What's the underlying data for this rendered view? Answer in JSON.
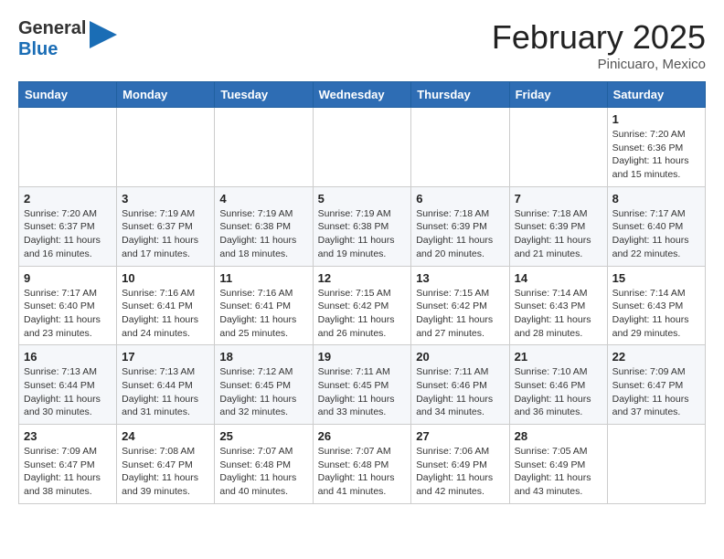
{
  "header": {
    "logo_general": "General",
    "logo_blue": "Blue",
    "month_title": "February 2025",
    "subtitle": "Pinicuaro, Mexico"
  },
  "days_of_week": [
    "Sunday",
    "Monday",
    "Tuesday",
    "Wednesday",
    "Thursday",
    "Friday",
    "Saturday"
  ],
  "weeks": [
    [
      {
        "day": "",
        "info": ""
      },
      {
        "day": "",
        "info": ""
      },
      {
        "day": "",
        "info": ""
      },
      {
        "day": "",
        "info": ""
      },
      {
        "day": "",
        "info": ""
      },
      {
        "day": "",
        "info": ""
      },
      {
        "day": "1",
        "info": "Sunrise: 7:20 AM\nSunset: 6:36 PM\nDaylight: 11 hours\nand 15 minutes."
      }
    ],
    [
      {
        "day": "2",
        "info": "Sunrise: 7:20 AM\nSunset: 6:37 PM\nDaylight: 11 hours\nand 16 minutes."
      },
      {
        "day": "3",
        "info": "Sunrise: 7:19 AM\nSunset: 6:37 PM\nDaylight: 11 hours\nand 17 minutes."
      },
      {
        "day": "4",
        "info": "Sunrise: 7:19 AM\nSunset: 6:38 PM\nDaylight: 11 hours\nand 18 minutes."
      },
      {
        "day": "5",
        "info": "Sunrise: 7:19 AM\nSunset: 6:38 PM\nDaylight: 11 hours\nand 19 minutes."
      },
      {
        "day": "6",
        "info": "Sunrise: 7:18 AM\nSunset: 6:39 PM\nDaylight: 11 hours\nand 20 minutes."
      },
      {
        "day": "7",
        "info": "Sunrise: 7:18 AM\nSunset: 6:39 PM\nDaylight: 11 hours\nand 21 minutes."
      },
      {
        "day": "8",
        "info": "Sunrise: 7:17 AM\nSunset: 6:40 PM\nDaylight: 11 hours\nand 22 minutes."
      }
    ],
    [
      {
        "day": "9",
        "info": "Sunrise: 7:17 AM\nSunset: 6:40 PM\nDaylight: 11 hours\nand 23 minutes."
      },
      {
        "day": "10",
        "info": "Sunrise: 7:16 AM\nSunset: 6:41 PM\nDaylight: 11 hours\nand 24 minutes."
      },
      {
        "day": "11",
        "info": "Sunrise: 7:16 AM\nSunset: 6:41 PM\nDaylight: 11 hours\nand 25 minutes."
      },
      {
        "day": "12",
        "info": "Sunrise: 7:15 AM\nSunset: 6:42 PM\nDaylight: 11 hours\nand 26 minutes."
      },
      {
        "day": "13",
        "info": "Sunrise: 7:15 AM\nSunset: 6:42 PM\nDaylight: 11 hours\nand 27 minutes."
      },
      {
        "day": "14",
        "info": "Sunrise: 7:14 AM\nSunset: 6:43 PM\nDaylight: 11 hours\nand 28 minutes."
      },
      {
        "day": "15",
        "info": "Sunrise: 7:14 AM\nSunset: 6:43 PM\nDaylight: 11 hours\nand 29 minutes."
      }
    ],
    [
      {
        "day": "16",
        "info": "Sunrise: 7:13 AM\nSunset: 6:44 PM\nDaylight: 11 hours\nand 30 minutes."
      },
      {
        "day": "17",
        "info": "Sunrise: 7:13 AM\nSunset: 6:44 PM\nDaylight: 11 hours\nand 31 minutes."
      },
      {
        "day": "18",
        "info": "Sunrise: 7:12 AM\nSunset: 6:45 PM\nDaylight: 11 hours\nand 32 minutes."
      },
      {
        "day": "19",
        "info": "Sunrise: 7:11 AM\nSunset: 6:45 PM\nDaylight: 11 hours\nand 33 minutes."
      },
      {
        "day": "20",
        "info": "Sunrise: 7:11 AM\nSunset: 6:46 PM\nDaylight: 11 hours\nand 34 minutes."
      },
      {
        "day": "21",
        "info": "Sunrise: 7:10 AM\nSunset: 6:46 PM\nDaylight: 11 hours\nand 36 minutes."
      },
      {
        "day": "22",
        "info": "Sunrise: 7:09 AM\nSunset: 6:47 PM\nDaylight: 11 hours\nand 37 minutes."
      }
    ],
    [
      {
        "day": "23",
        "info": "Sunrise: 7:09 AM\nSunset: 6:47 PM\nDaylight: 11 hours\nand 38 minutes."
      },
      {
        "day": "24",
        "info": "Sunrise: 7:08 AM\nSunset: 6:47 PM\nDaylight: 11 hours\nand 39 minutes."
      },
      {
        "day": "25",
        "info": "Sunrise: 7:07 AM\nSunset: 6:48 PM\nDaylight: 11 hours\nand 40 minutes."
      },
      {
        "day": "26",
        "info": "Sunrise: 7:07 AM\nSunset: 6:48 PM\nDaylight: 11 hours\nand 41 minutes."
      },
      {
        "day": "27",
        "info": "Sunrise: 7:06 AM\nSunset: 6:49 PM\nDaylight: 11 hours\nand 42 minutes."
      },
      {
        "day": "28",
        "info": "Sunrise: 7:05 AM\nSunset: 6:49 PM\nDaylight: 11 hours\nand 43 minutes."
      },
      {
        "day": "",
        "info": ""
      }
    ]
  ]
}
